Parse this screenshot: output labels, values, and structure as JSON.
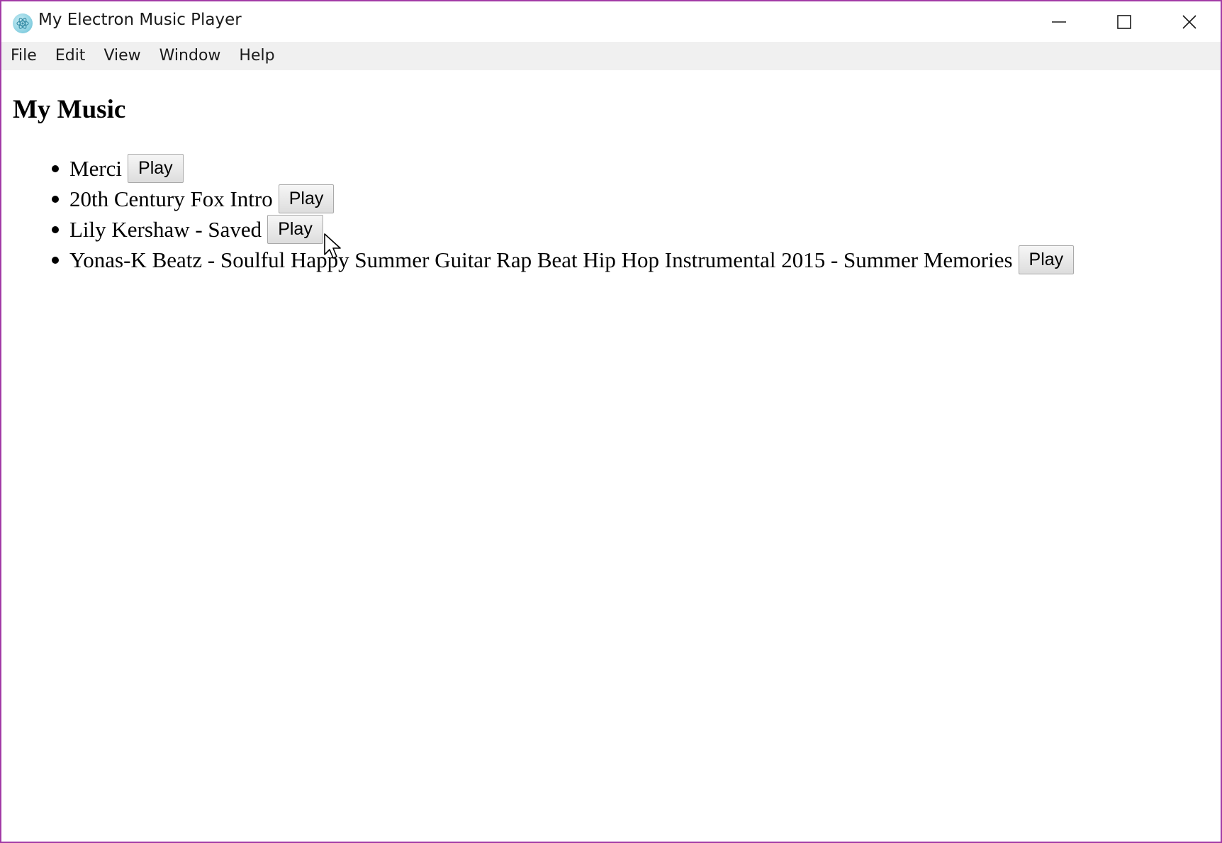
{
  "window": {
    "title": "My Electron Music Player",
    "app_icon": "electron-icon",
    "controls": {
      "minimize_icon": "minimize-icon",
      "maximize_icon": "maximize-icon",
      "close_icon": "close-icon"
    }
  },
  "menu": {
    "items": [
      {
        "label": "File"
      },
      {
        "label": "Edit"
      },
      {
        "label": "View"
      },
      {
        "label": "Window"
      },
      {
        "label": "Help"
      }
    ]
  },
  "main": {
    "title": "My Music",
    "tracks": [
      {
        "name": "Merci",
        "button_label": "Play"
      },
      {
        "name": "20th Century Fox Intro",
        "button_label": "Play"
      },
      {
        "name": "Lily Kershaw - Saved",
        "button_label": "Play"
      },
      {
        "name": "Yonas-K Beatz - Soulful Happy Summer Guitar Rap Beat Hip Hop Instrumental 2015 - Summer Memories",
        "button_label": "Play"
      }
    ]
  },
  "colors": {
    "window_border": "#a23ba6",
    "menubar_bg": "#f0f0f0"
  }
}
